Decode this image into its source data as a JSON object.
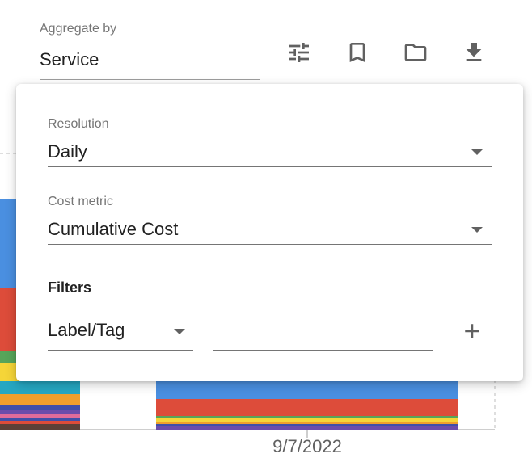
{
  "toolbar": {
    "aggregate_label": "Aggregate by",
    "aggregate_value": "Service",
    "buttons": [
      {
        "name": "tune-button",
        "icon": "tune-icon"
      },
      {
        "name": "bookmark-button",
        "icon": "bookmark-icon"
      },
      {
        "name": "folder-button",
        "icon": "folder-icon"
      },
      {
        "name": "download-button",
        "icon": "download-icon"
      }
    ]
  },
  "chart": {
    "x_tick_label": "9/7/2022",
    "series_colors": [
      "#4a8fe0",
      "#dd4c3a",
      "#57a55a",
      "#f5d538",
      "#ef9f2c",
      "#3f4fa8",
      "#e06b9a",
      "#26a7c2",
      "#6a4cab",
      "#5d4037"
    ]
  },
  "popup": {
    "resolution_label": "Resolution",
    "resolution_value": "Daily",
    "cost_metric_label": "Cost metric",
    "cost_metric_value": "Cumulative Cost",
    "filters_title": "Filters",
    "filter_type_value": "Label/Tag",
    "filter_value": ""
  }
}
